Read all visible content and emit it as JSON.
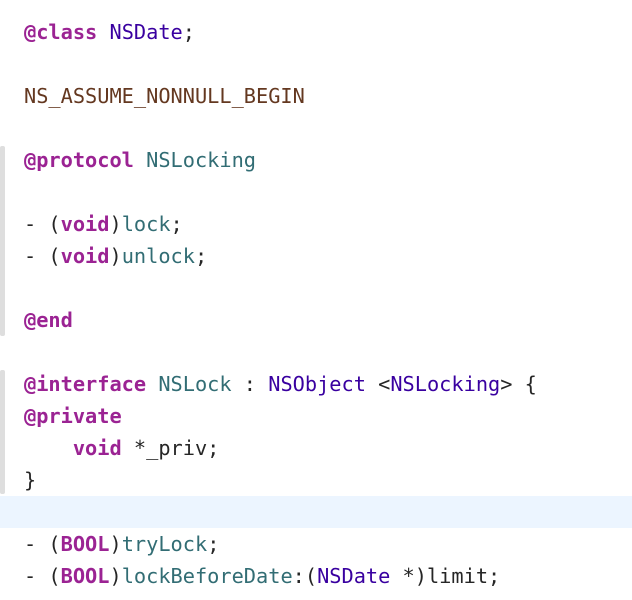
{
  "editor": {
    "current_line_index": 15,
    "lines": [
      [
        {
          "t": "@class",
          "c": "kw"
        },
        {
          "t": " ",
          "c": "plain"
        },
        {
          "t": "NSDate",
          "c": "type"
        },
        {
          "t": ";",
          "c": "plain"
        }
      ],
      [],
      [
        {
          "t": "NS_ASSUME_NONNULL_BEGIN",
          "c": "macro"
        }
      ],
      [],
      [
        {
          "t": "@protocol",
          "c": "kw"
        },
        {
          "t": " ",
          "c": "plain"
        },
        {
          "t": "NSLocking",
          "c": "method"
        }
      ],
      [],
      [
        {
          "t": "- (",
          "c": "plain"
        },
        {
          "t": "void",
          "c": "kw"
        },
        {
          "t": ")",
          "c": "plain"
        },
        {
          "t": "lock",
          "c": "method"
        },
        {
          "t": ";",
          "c": "plain"
        }
      ],
      [
        {
          "t": "- (",
          "c": "plain"
        },
        {
          "t": "void",
          "c": "kw"
        },
        {
          "t": ")",
          "c": "plain"
        },
        {
          "t": "unlock",
          "c": "method"
        },
        {
          "t": ";",
          "c": "plain"
        }
      ],
      [],
      [
        {
          "t": "@end",
          "c": "kw"
        }
      ],
      [],
      [
        {
          "t": "@interface",
          "c": "kw"
        },
        {
          "t": " ",
          "c": "plain"
        },
        {
          "t": "NSLock",
          "c": "method"
        },
        {
          "t": " : ",
          "c": "plain"
        },
        {
          "t": "NSObject",
          "c": "type"
        },
        {
          "t": " <",
          "c": "plain"
        },
        {
          "t": "NSLocking",
          "c": "type"
        },
        {
          "t": "> {",
          "c": "plain"
        }
      ],
      [
        {
          "t": "@private",
          "c": "kw"
        }
      ],
      [
        {
          "t": "    ",
          "c": "plain"
        },
        {
          "t": "void",
          "c": "kw"
        },
        {
          "t": " *_priv;",
          "c": "plain"
        }
      ],
      [
        {
          "t": "}",
          "c": "plain"
        }
      ],
      [],
      [
        {
          "t": "- (",
          "c": "plain"
        },
        {
          "t": "BOOL",
          "c": "kw"
        },
        {
          "t": ")",
          "c": "plain"
        },
        {
          "t": "tryLock",
          "c": "method"
        },
        {
          "t": ";",
          "c": "plain"
        }
      ],
      [
        {
          "t": "- (",
          "c": "plain"
        },
        {
          "t": "BOOL",
          "c": "kw"
        },
        {
          "t": ")",
          "c": "plain"
        },
        {
          "t": "lockBeforeDate",
          "c": "method"
        },
        {
          "t": ":(",
          "c": "plain"
        },
        {
          "t": "NSDate",
          "c": "type"
        },
        {
          "t": " *)limit;",
          "c": "plain"
        }
      ]
    ]
  }
}
